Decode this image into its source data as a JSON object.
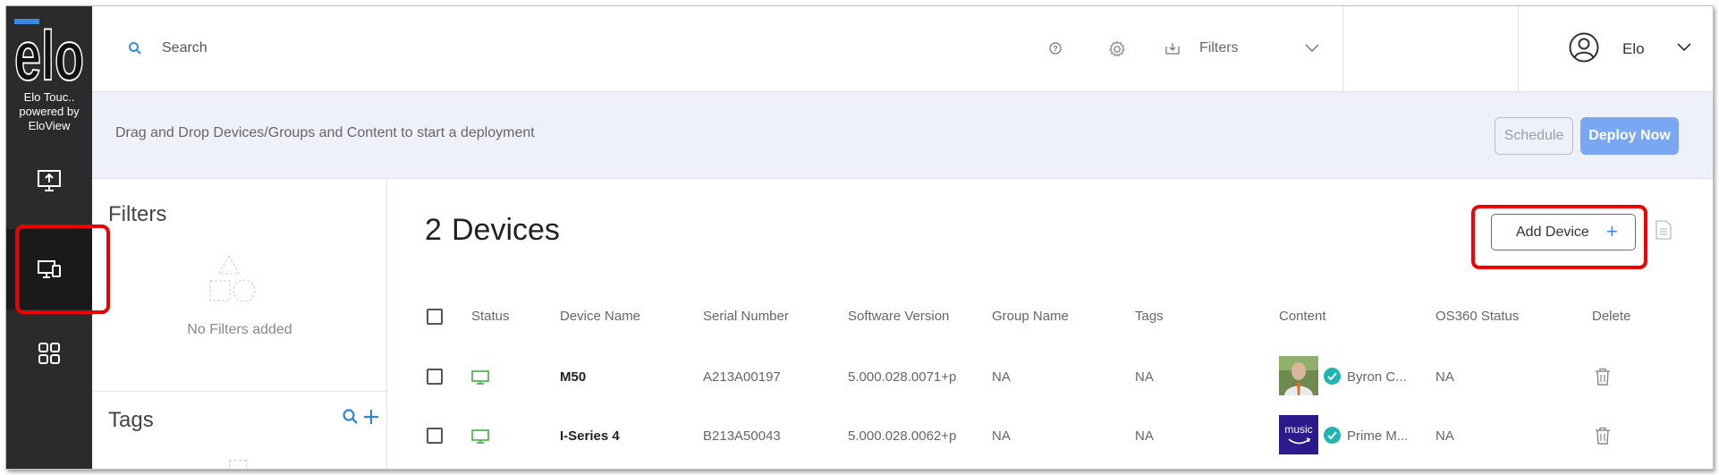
{
  "sidebar": {
    "org_line1": "Elo Touc..",
    "org_line2": "powered by",
    "org_line3": "EloView",
    "items": [
      {
        "name": "upload"
      },
      {
        "name": "devices"
      },
      {
        "name": "apps"
      }
    ]
  },
  "topbar": {
    "search_placeholder": "Search",
    "filters_label": "Filters",
    "user_name": "Elo"
  },
  "banner": {
    "text": "Drag and Drop Devices/Groups and Content to start a deployment",
    "schedule_label": "Schedule",
    "deploy_label": "Deploy Now"
  },
  "filters_panel": {
    "title": "Filters",
    "empty_text": "No Filters added",
    "tags_title": "Tags"
  },
  "devices": {
    "count": "2",
    "count_label": "Devices",
    "add_device_label": "Add Device",
    "columns": [
      "Status",
      "Device Name",
      "Serial Number",
      "Software Version",
      "Group Name",
      "Tags",
      "Content",
      "OS360 Status",
      "Delete"
    ],
    "rows": [
      {
        "status": "online",
        "name": "M50",
        "serial": "A213A00197",
        "software": "5.000.028.0071+p",
        "group": "NA",
        "tags": "NA",
        "content": "Byron C...",
        "os360": "NA"
      },
      {
        "status": "online",
        "name": "I-Series 4",
        "serial": "B213A50043",
        "software": "5.000.028.0062+p",
        "group": "NA",
        "tags": "NA",
        "content": "Prime M...",
        "os360": "NA"
      }
    ]
  },
  "colors": {
    "rail": "#2b2b2b",
    "accent": "#3a8be0",
    "deploy_button": "#7aa7f2",
    "status_online": "#3cb043",
    "highlight": "#ee0000"
  }
}
